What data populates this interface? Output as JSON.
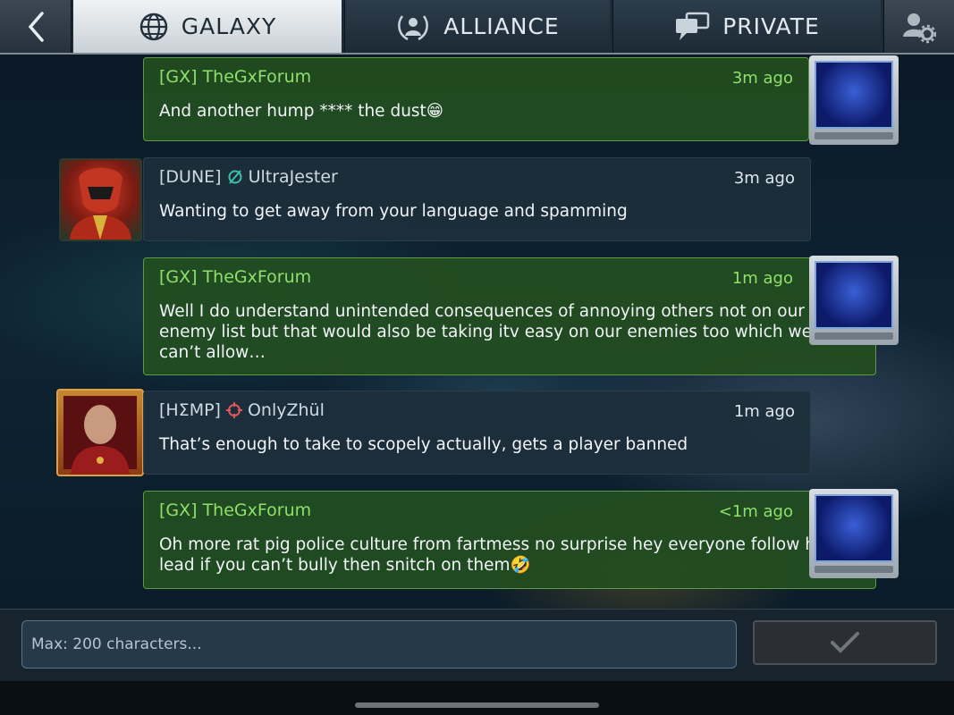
{
  "header": {
    "tabs": [
      {
        "label": "GALAXY",
        "icon": "globe-icon",
        "active": true
      },
      {
        "label": "ALLIANCE",
        "icon": "alliance-laurel-icon",
        "active": false
      },
      {
        "label": "PRIVATE",
        "icon": "chat-bubbles-icon",
        "active": false
      }
    ]
  },
  "messages": [
    {
      "tag": "[GX]",
      "name": "TheGxForum",
      "time": "3m ago",
      "text": "And another hump **** the dust😁",
      "style": "own"
    },
    {
      "tag": "[DUNE]",
      "name": "UltraJester",
      "time": "3m ago",
      "text": "Wanting to get away from your language and spamming",
      "style": "other",
      "alliance_icon": "empty-set-icon"
    },
    {
      "tag": "[GX]",
      "name": "TheGxForum",
      "time": "1m ago",
      "text": "Well I do understand unintended consequences of annoying others not on our\nenemy list but that would also be taking itv easy on our enemies too which we\ncan’t allow…",
      "style": "own"
    },
    {
      "tag": "[HΣMP]",
      "name": "OnlyZhül",
      "time": "1m ago",
      "text": "That’s enough to take to scopely actually, gets a player banned",
      "style": "other",
      "alliance_icon": "crosshair-icon"
    },
    {
      "tag": "[GX]",
      "name": "TheGxForum",
      "time": "<1m ago",
      "text": "Oh more rat pig police culture from fartmess no surprise hey everyone follow his\nlead if you can’t bully then snitch on them🤣",
      "style": "own"
    }
  ],
  "composer": {
    "placeholder": "Max: 200 characters...",
    "value": ""
  },
  "colors": {
    "own_bubble": "#224e20",
    "own_text_accent": "#8fe06a",
    "other_bubble": "#1e2f3c"
  }
}
